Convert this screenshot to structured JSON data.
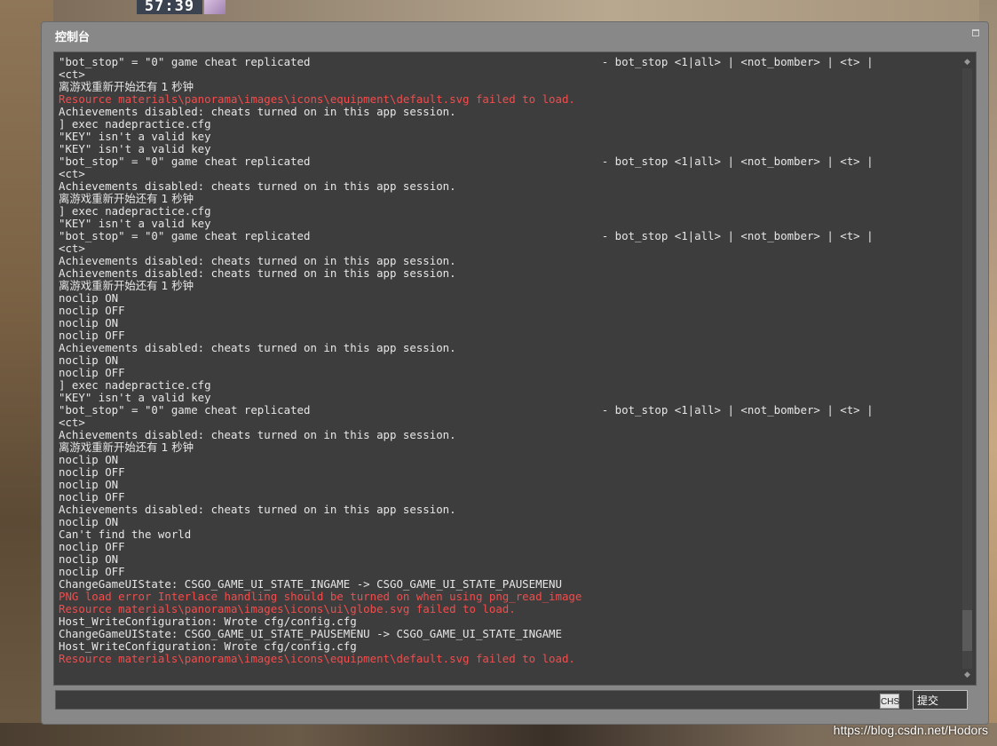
{
  "hud": {
    "timer": "57:39"
  },
  "window": {
    "title": "控制台",
    "submit_label": "提交",
    "ime_label": "CHS",
    "input_value": ""
  },
  "log": [
    {
      "text": "\"bot_stop\" = \"0\" game cheat replicated                                            - bot_stop <1|all> | <not_bomber> | <t> |",
      "type": "normal"
    },
    {
      "text": "<ct>",
      "type": "normal"
    },
    {
      "text": "离游戏重新开始还有 1 秒钟",
      "type": "cjk"
    },
    {
      "text": "Resource materials\\panorama\\images\\icons\\equipment\\default.svg failed to load.",
      "type": "error"
    },
    {
      "text": "Achievements disabled: cheats turned on in this app session.",
      "type": "normal"
    },
    {
      "text": "] exec nadepractice.cfg",
      "type": "normal"
    },
    {
      "text": "\"KEY\" isn't a valid key",
      "type": "normal"
    },
    {
      "text": "\"KEY\" isn't a valid key",
      "type": "normal"
    },
    {
      "text": "\"bot_stop\" = \"0\" game cheat replicated                                            - bot_stop <1|all> | <not_bomber> | <t> |",
      "type": "normal"
    },
    {
      "text": "<ct>",
      "type": "normal"
    },
    {
      "text": "Achievements disabled: cheats turned on in this app session.",
      "type": "normal"
    },
    {
      "text": "离游戏重新开始还有 1 秒钟",
      "type": "cjk"
    },
    {
      "text": "] exec nadepractice.cfg",
      "type": "normal"
    },
    {
      "text": "\"KEY\" isn't a valid key",
      "type": "normal"
    },
    {
      "text": "\"bot_stop\" = \"0\" game cheat replicated                                            - bot_stop <1|all> | <not_bomber> | <t> |",
      "type": "normal"
    },
    {
      "text": "<ct>",
      "type": "normal"
    },
    {
      "text": "Achievements disabled: cheats turned on in this app session.",
      "type": "normal"
    },
    {
      "text": "Achievements disabled: cheats turned on in this app session.",
      "type": "normal"
    },
    {
      "text": "离游戏重新开始还有 1 秒钟",
      "type": "cjk"
    },
    {
      "text": "noclip ON",
      "type": "normal"
    },
    {
      "text": "noclip OFF",
      "type": "normal"
    },
    {
      "text": "noclip ON",
      "type": "normal"
    },
    {
      "text": "noclip OFF",
      "type": "normal"
    },
    {
      "text": "Achievements disabled: cheats turned on in this app session.",
      "type": "normal"
    },
    {
      "text": "noclip ON",
      "type": "normal"
    },
    {
      "text": "noclip OFF",
      "type": "normal"
    },
    {
      "text": "] exec nadepractice.cfg",
      "type": "normal"
    },
    {
      "text": "\"KEY\" isn't a valid key",
      "type": "normal"
    },
    {
      "text": "\"bot_stop\" = \"0\" game cheat replicated                                            - bot_stop <1|all> | <not_bomber> | <t> |",
      "type": "normal"
    },
    {
      "text": "<ct>",
      "type": "normal"
    },
    {
      "text": "Achievements disabled: cheats turned on in this app session.",
      "type": "normal"
    },
    {
      "text": "离游戏重新开始还有 1 秒钟",
      "type": "cjk"
    },
    {
      "text": "noclip ON",
      "type": "normal"
    },
    {
      "text": "noclip OFF",
      "type": "normal"
    },
    {
      "text": "noclip ON",
      "type": "normal"
    },
    {
      "text": "noclip OFF",
      "type": "normal"
    },
    {
      "text": "Achievements disabled: cheats turned on in this app session.",
      "type": "normal"
    },
    {
      "text": "noclip ON",
      "type": "normal"
    },
    {
      "text": "Can't find the world",
      "type": "normal"
    },
    {
      "text": "noclip OFF",
      "type": "normal"
    },
    {
      "text": "noclip ON",
      "type": "normal"
    },
    {
      "text": "noclip OFF",
      "type": "normal"
    },
    {
      "text": "ChangeGameUIState: CSGO_GAME_UI_STATE_INGAME -> CSGO_GAME_UI_STATE_PAUSEMENU",
      "type": "normal"
    },
    {
      "text": "PNG load error Interlace handling should be turned on when using png_read_image",
      "type": "error"
    },
    {
      "text": "Resource materials\\panorama\\images\\icons\\ui\\globe.svg failed to load.",
      "type": "error"
    },
    {
      "text": "Host_WriteConfiguration: Wrote cfg/config.cfg",
      "type": "normal"
    },
    {
      "text": "ChangeGameUIState: CSGO_GAME_UI_STATE_PAUSEMENU -> CSGO_GAME_UI_STATE_INGAME",
      "type": "normal"
    },
    {
      "text": "Host_WriteConfiguration: Wrote cfg/config.cfg",
      "type": "normal"
    },
    {
      "text": "Resource materials\\panorama\\images\\icons\\equipment\\default.svg failed to load.",
      "type": "error"
    }
  ],
  "watermark": "https://blog.csdn.net/Hodors",
  "colors": {
    "error": "#f24c4c",
    "text": "#e6e6e6",
    "panel": "#3d3d3d",
    "frame": "#888888"
  }
}
